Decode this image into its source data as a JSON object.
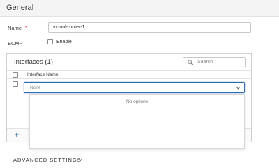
{
  "section": {
    "title": "General"
  },
  "form": {
    "name_label": "Name",
    "required_mark": "*",
    "name_value": "virtual-router-1",
    "ecmp_label": "ECMP",
    "ecmp_enable_label": "Enable"
  },
  "interfaces": {
    "title": "Interfaces (1)",
    "search_placeholder": "Search",
    "column_header": "Interface Name",
    "row_select_value": "None",
    "dropdown_empty_text": "No options",
    "add_symbol": "+",
    "remove_symbol": "−"
  },
  "advanced": {
    "label": "ADVANCED SETTINGS"
  },
  "colors": {
    "accent": "#2b6cb0",
    "required": "#d9363e",
    "header_bg": "#f4f4f4"
  },
  "icons": [
    "search-icon",
    "chevron-down-icon",
    "plus-icon",
    "minus-icon"
  ]
}
